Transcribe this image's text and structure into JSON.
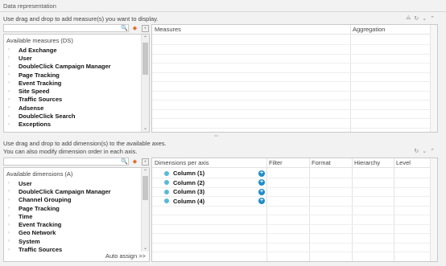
{
  "section_title": "Data representation",
  "measures": {
    "instruction": "Use drag and drop to add measure(s) you want to display.",
    "controls": {
      "filter_icon": "filter-icon",
      "reset": "↺",
      "collapse": "⌃"
    },
    "search_placeholder": "",
    "list_title": "Available measures (DS)",
    "items": [
      "Ad Exchange",
      "User",
      "DoubleClick Campaign Manager",
      "Page Tracking",
      "Event Tracking",
      "Site Speed",
      "Traffic Sources",
      "Adsense",
      "DoubleClick Search",
      "Exceptions"
    ],
    "grid_headers": {
      "measures": "Measures",
      "aggregation": "Aggregation"
    }
  },
  "dimensions": {
    "instruction_line1": "Use drag and drop to add dimension(s) to the available axes.",
    "instruction_line2": "You can also modify dimension order in each axis.",
    "search_placeholder": "",
    "list_title": "Available dimensions (A)",
    "items": [
      "User",
      "DoubleClick Campaign Manager",
      "Channel Grouping",
      "Page Tracking",
      "Time",
      "Event Tracking",
      "Geo Network",
      "System",
      "Traffic Sources"
    ],
    "auto_assign": "Auto assign >>",
    "grid_headers": {
      "axis": "Dimensions per axis",
      "filter": "Filter",
      "format": "Format",
      "hierarchy": "Hierarchy",
      "level": "Level"
    },
    "columns": [
      "Column (1)",
      "Column (2)",
      "Column (3)",
      "Column (4)"
    ]
  }
}
